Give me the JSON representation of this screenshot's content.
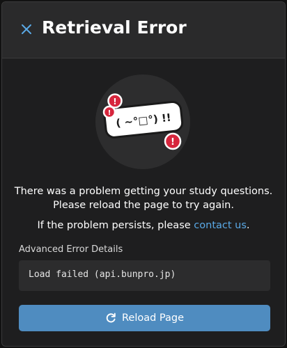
{
  "modal": {
    "title": "Retrieval Error",
    "close_icon": "close-icon"
  },
  "illustration": {
    "kaomoji": "( ~°□°) !!",
    "badge_symbol": "!",
    "icon": "error-kaomoji-icon"
  },
  "message": {
    "line1": "There was a problem getting your study questions.",
    "line2": "Please reload the page to try again.",
    "persist_prefix": "If the problem persists, please ",
    "contact_link": "contact us",
    "persist_suffix": "."
  },
  "details": {
    "label": "Advanced Error Details",
    "error_text": "Load failed (api.bunpro.jp)"
  },
  "reload_button": {
    "label": "Reload Page",
    "icon": "refresh-icon"
  },
  "colors": {
    "accent": "#5aa9e6",
    "button": "#4f8cc0",
    "badge": "#d7263d",
    "background": "#1e1e1f"
  }
}
